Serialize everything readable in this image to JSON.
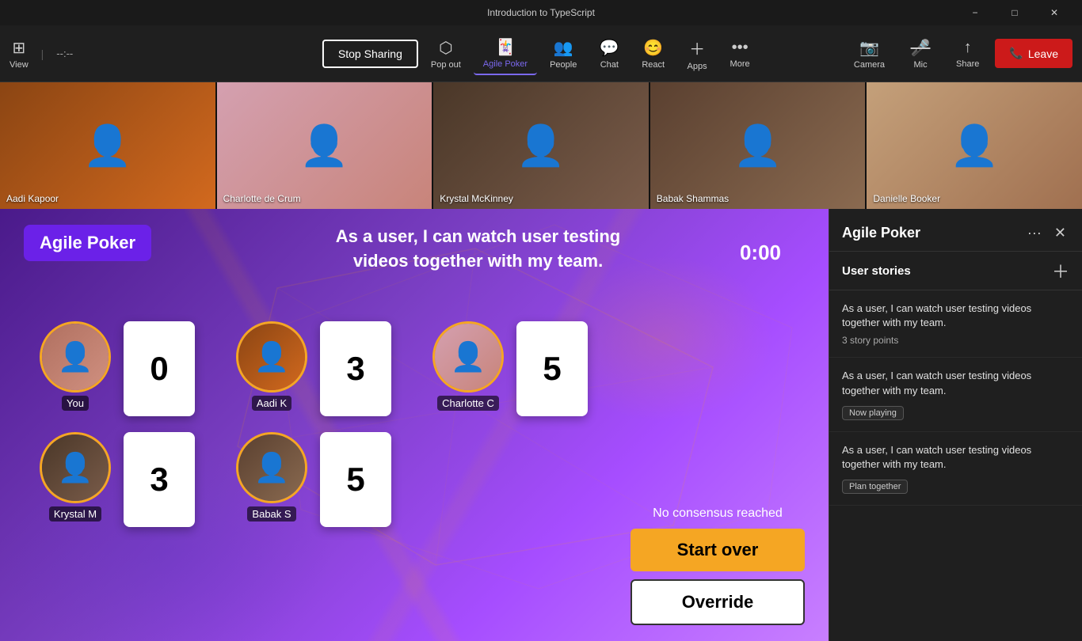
{
  "titleBar": {
    "title": "Introduction to TypeScript",
    "minimize": "−",
    "maximize": "□",
    "close": "✕"
  },
  "toolbar": {
    "view_label": "View",
    "timer_display": "--:--",
    "stop_sharing": "Stop Sharing",
    "pop_out": "Pop out",
    "agile_poker": "Agile Poker",
    "people": "People",
    "chat": "Chat",
    "react": "React",
    "apps": "Apps",
    "more": "More",
    "camera": "Camera",
    "mic": "Mic",
    "share": "Share",
    "leave": "Leave"
  },
  "videoStrip": {
    "participants": [
      {
        "name": "Aadi Kapoor",
        "face": "face-aadi"
      },
      {
        "name": "Charlotte de Crum",
        "face": "face-charlotte"
      },
      {
        "name": "Krystal McKinney",
        "face": "face-krystal"
      },
      {
        "name": "Babak Shammas",
        "face": "face-babak"
      },
      {
        "name": "Danielle Booker",
        "face": "face-danielle"
      }
    ]
  },
  "gameArea": {
    "appName": "Agile Poker",
    "storyTitle": "As a user, I can watch user testing\nvideos together with my team.",
    "timer": "0:00",
    "noConsensus": "No consensus reached",
    "startOver": "Start over",
    "override": "Override",
    "players": [
      {
        "id": "you",
        "name": "You",
        "card": "0",
        "face": "face-you"
      },
      {
        "id": "aadi",
        "name": "Aadi K",
        "card": "3",
        "face": "face-aadi"
      },
      {
        "id": "charlotte",
        "name": "Charlotte C",
        "card": "5",
        "face": "face-charlotte"
      }
    ],
    "players2": [
      {
        "id": "krystal",
        "name": "Krystal M",
        "card": "3",
        "face": "face-krystal"
      },
      {
        "id": "babak",
        "name": "Babak S",
        "card": "5",
        "face": "face-babak"
      }
    ]
  },
  "sidebar": {
    "title": "Agile Poker",
    "userStoriesLabel": "User stories",
    "stories": [
      {
        "text": "As a user, I can watch user testing videos together with my team.",
        "meta": "3 story points",
        "badge": null
      },
      {
        "text": "As a user, I can watch user testing videos together with my team.",
        "meta": null,
        "badge": "Now playing"
      },
      {
        "text": "As a user, I can watch user testing videos together with my team.",
        "meta": null,
        "badge": "Plan together"
      }
    ]
  }
}
